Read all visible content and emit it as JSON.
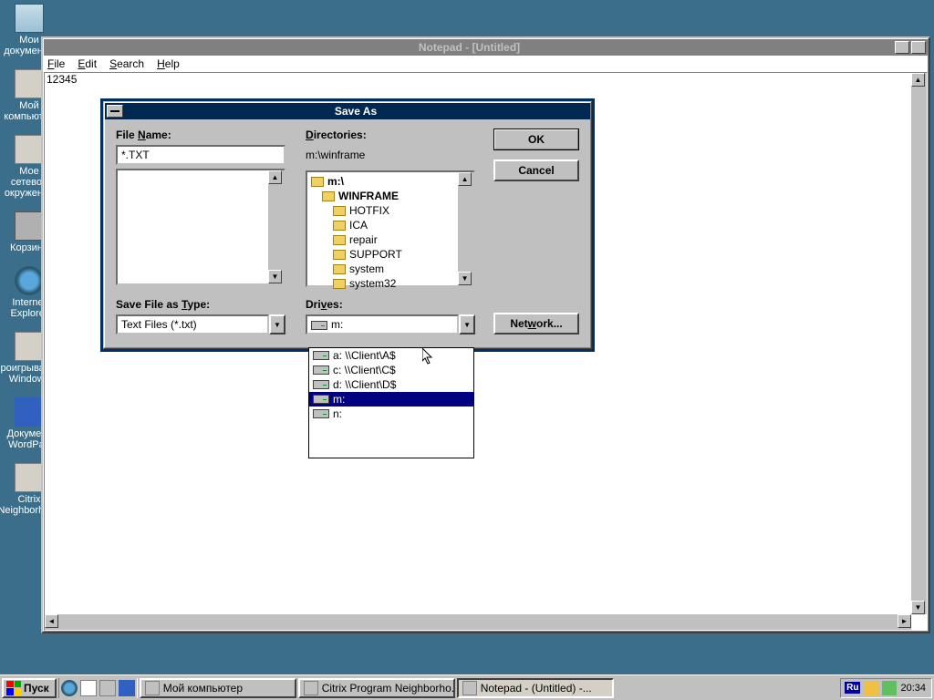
{
  "desktop": {
    "icons": [
      {
        "label": "Мои документы"
      },
      {
        "label": "Мой компьютер"
      },
      {
        "label": "Мое сетевое окружение"
      },
      {
        "label": "Корзина"
      },
      {
        "label": "Internet Explorer"
      },
      {
        "label": "Проигрыватель Windows"
      },
      {
        "label": "Документ WordPad"
      },
      {
        "label": "Citrix Neighborhood"
      }
    ]
  },
  "colors": {
    "desktop_bg": "#3a6e8a",
    "dlg_title_bg": "#002850",
    "selection": "#000080"
  },
  "notepad": {
    "title": "Notepad - [Untitled]",
    "menu": {
      "file": "File",
      "edit": "Edit",
      "search": "Search",
      "help": "Help"
    },
    "document_text": "12345"
  },
  "save_as": {
    "title": "Save As",
    "file_name_label": "File Name:",
    "file_name_value": "*.TXT",
    "directories_label": "Directories:",
    "current_path": "m:\\winframe",
    "tree": [
      {
        "label": "m:\\",
        "indent": 0,
        "open": true
      },
      {
        "label": "WINFRAME",
        "indent": 1,
        "open": true
      },
      {
        "label": "HOTFIX",
        "indent": 2,
        "open": false
      },
      {
        "label": "ICA",
        "indent": 2,
        "open": false
      },
      {
        "label": "repair",
        "indent": 2,
        "open": false
      },
      {
        "label": "SUPPORT",
        "indent": 2,
        "open": false
      },
      {
        "label": "system",
        "indent": 2,
        "open": false
      },
      {
        "label": "system32",
        "indent": 2,
        "open": false
      }
    ],
    "save_type_label": "Save File as Type:",
    "save_type_value": "Text Files (*.txt)",
    "drives_label": "Drives:",
    "drives_value": "m:",
    "ok": "OK",
    "cancel": "Cancel",
    "network": "Network...",
    "drive_options": [
      {
        "label": "a: \\\\Client\\A$",
        "selected": false
      },
      {
        "label": "c: \\\\Client\\C$",
        "selected": false
      },
      {
        "label": "d: \\\\Client\\D$",
        "selected": false
      },
      {
        "label": "m:",
        "selected": true
      },
      {
        "label": "n:",
        "selected": false
      }
    ]
  },
  "taskbar": {
    "start": "Пуск",
    "tasks": [
      {
        "label": "Мой компьютер",
        "active": false
      },
      {
        "label": "Citrix Program Neighborho...",
        "active": false
      },
      {
        "label": "Notepad - (Untitled) -...",
        "active": true
      }
    ],
    "lang": "Ru",
    "clock": "20:34"
  }
}
